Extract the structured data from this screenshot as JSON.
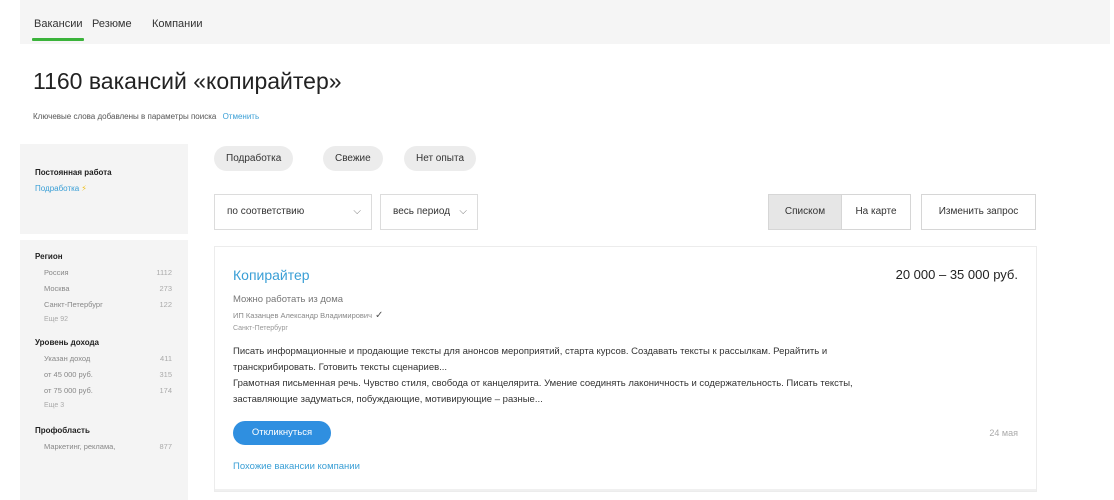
{
  "nav": {
    "tabs": [
      "Вакансии",
      "Резюме",
      "Компании"
    ],
    "active_tab": "Вакансии",
    "accent_color": "#3bb33b"
  },
  "search": {
    "title": "1160 вакансий «копирайтер»",
    "keywords_note": "Ключевые слова добавлены в параметры поиска",
    "cancel_label": "Отменить"
  },
  "sidebar": {
    "employment_heading": "Постоянная работа",
    "employment_link": "Подработка",
    "region": {
      "heading": "Регион",
      "items": [
        {
          "label": "Россия",
          "count": "1112"
        },
        {
          "label": "Москва",
          "count": "273"
        },
        {
          "label": "Санкт-Петербург",
          "count": "122"
        }
      ],
      "more": "Еще 92"
    },
    "income": {
      "heading": "Уровень дохода",
      "items": [
        {
          "label": "Указан доход",
          "count": "411"
        },
        {
          "label": "от 45 000 руб.",
          "count": "315"
        },
        {
          "label": "от 75 000 руб.",
          "count": "174"
        }
      ],
      "more": "Еще 3"
    },
    "profarea": {
      "heading": "Профобласть",
      "items": [
        {
          "label": "Маркетинг, реклама,",
          "count": "877"
        }
      ]
    }
  },
  "filters": {
    "chips": [
      "Подработка",
      "Свежие",
      "Нет опыта"
    ],
    "sort": {
      "value": "по соответствию"
    },
    "period": {
      "value": "весь период"
    },
    "view_list": "Списком",
    "view_map": "На карте",
    "change_query": "Изменить запрос"
  },
  "vacancy": {
    "title": "Копирайтер",
    "salary": "20 000 – 35 000 руб.",
    "remote": "Можно работать из дома",
    "employer": "ИП Казанцев Александр Владимирович",
    "city": "Санкт-Петербург",
    "desc_lines": [
      "Писать информационные и продающие тексты для анонсов мероприятий, старта курсов. Создавать тексты к рассылкам. Рерайтить и",
      "транскрибировать. Готовить тексты сценариев...",
      "Грамотная письменная речь. Чувство стиля, свобода от канцелярита. Умение соединять лаконичность и содержательность. Писать тексты,",
      "заставляющие задуматься, побуждающие, мотивирующие – разные..."
    ],
    "apply_label": "Откликнуться",
    "date": "24 мая",
    "similar_link": "Похожие вакансии компании"
  },
  "icons": {
    "verified": "check-icon",
    "dropdown": "chevron-down-icon",
    "lightning": "lightning-icon"
  },
  "colors": {
    "link": "#3a9fd6",
    "primary_button": "#2f8fe0"
  }
}
